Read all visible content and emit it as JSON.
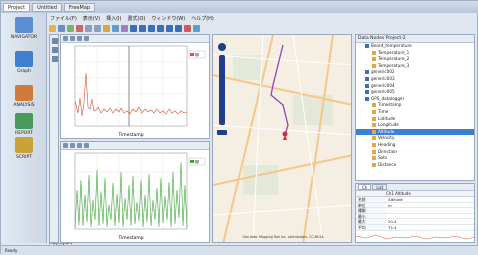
{
  "window": {
    "tabs": [
      "Project",
      "Untitled",
      "FreeMap"
    ]
  },
  "menu": [
    "ファイル(F)",
    "表示(V)",
    "挿入(I)",
    "書式(O)",
    "ウィンドウ(W)",
    "ヘルプ(H)"
  ],
  "sidebar": [
    {
      "label": "NAVIGATOR",
      "icon": "navigator-icon",
      "color": "#5a8fd6"
    },
    {
      "label": "Graph",
      "icon": "graph-icon",
      "color": "#3f7fcf"
    },
    {
      "label": "ANALYSIS",
      "icon": "analysis-icon",
      "color": "#d07a3a"
    },
    {
      "label": "REPORT",
      "icon": "report-icon",
      "color": "#4a9a5a"
    },
    {
      "label": "SCRIPT",
      "icon": "script-icon",
      "color": "#c9a23a"
    }
  ],
  "chart_top": {
    "xlabel": "Timestamp",
    "legend": "W"
  },
  "chart_bottom": {
    "xlabel": "Timestamp",
    "legend": "W"
  },
  "map": {
    "attribution": "Geo data: Mapping Tool Inc. contributors, CC-BY-SA"
  },
  "tree": {
    "title": "Data Nodes  Project-2",
    "items": [
      {
        "label": "Board_temperature",
        "indent": 1,
        "selected": false
      },
      {
        "label": "Temperature_1",
        "indent": 2,
        "selected": false
      },
      {
        "label": "Temperature_2",
        "indent": 2,
        "selected": false
      },
      {
        "label": "Temperature_3",
        "indent": 2,
        "selected": false
      },
      {
        "label": "generic002",
        "indent": 1,
        "selected": false
      },
      {
        "label": "generic003",
        "indent": 1,
        "selected": false
      },
      {
        "label": "generic004",
        "indent": 1,
        "selected": false
      },
      {
        "label": "generic005",
        "indent": 1,
        "selected": false
      },
      {
        "label": "GPS_datalogger",
        "indent": 1,
        "selected": false
      },
      {
        "label": "Timestamp",
        "indent": 2,
        "selected": false
      },
      {
        "label": "Time",
        "indent": 2,
        "selected": false
      },
      {
        "label": "Latitude",
        "indent": 2,
        "selected": false
      },
      {
        "label": "Longitude",
        "indent": 2,
        "selected": false
      },
      {
        "label": "Altitude",
        "indent": 2,
        "selected": true
      },
      {
        "label": "Velocity",
        "indent": 2,
        "selected": false
      },
      {
        "label": "Heading",
        "indent": 2,
        "selected": false
      },
      {
        "label": "Direction",
        "indent": 2,
        "selected": false
      },
      {
        "label": "Sats",
        "indent": 2,
        "selected": false
      },
      {
        "label": "Distance",
        "indent": 2,
        "selected": false
      }
    ]
  },
  "props": {
    "tabs": [
      "Ch",
      "List"
    ],
    "header": "Ch1 Altitude",
    "rows": [
      [
        "名前",
        "Altitude"
      ],
      [
        "単位",
        "m"
      ],
      [
        "種類",
        ""
      ],
      [
        "最小",
        ""
      ],
      [
        "最大",
        "20.4"
      ],
      [
        "平均",
        "75.4"
      ]
    ]
  },
  "status": "Ready",
  "sheet_tab": "Sheet 1"
}
